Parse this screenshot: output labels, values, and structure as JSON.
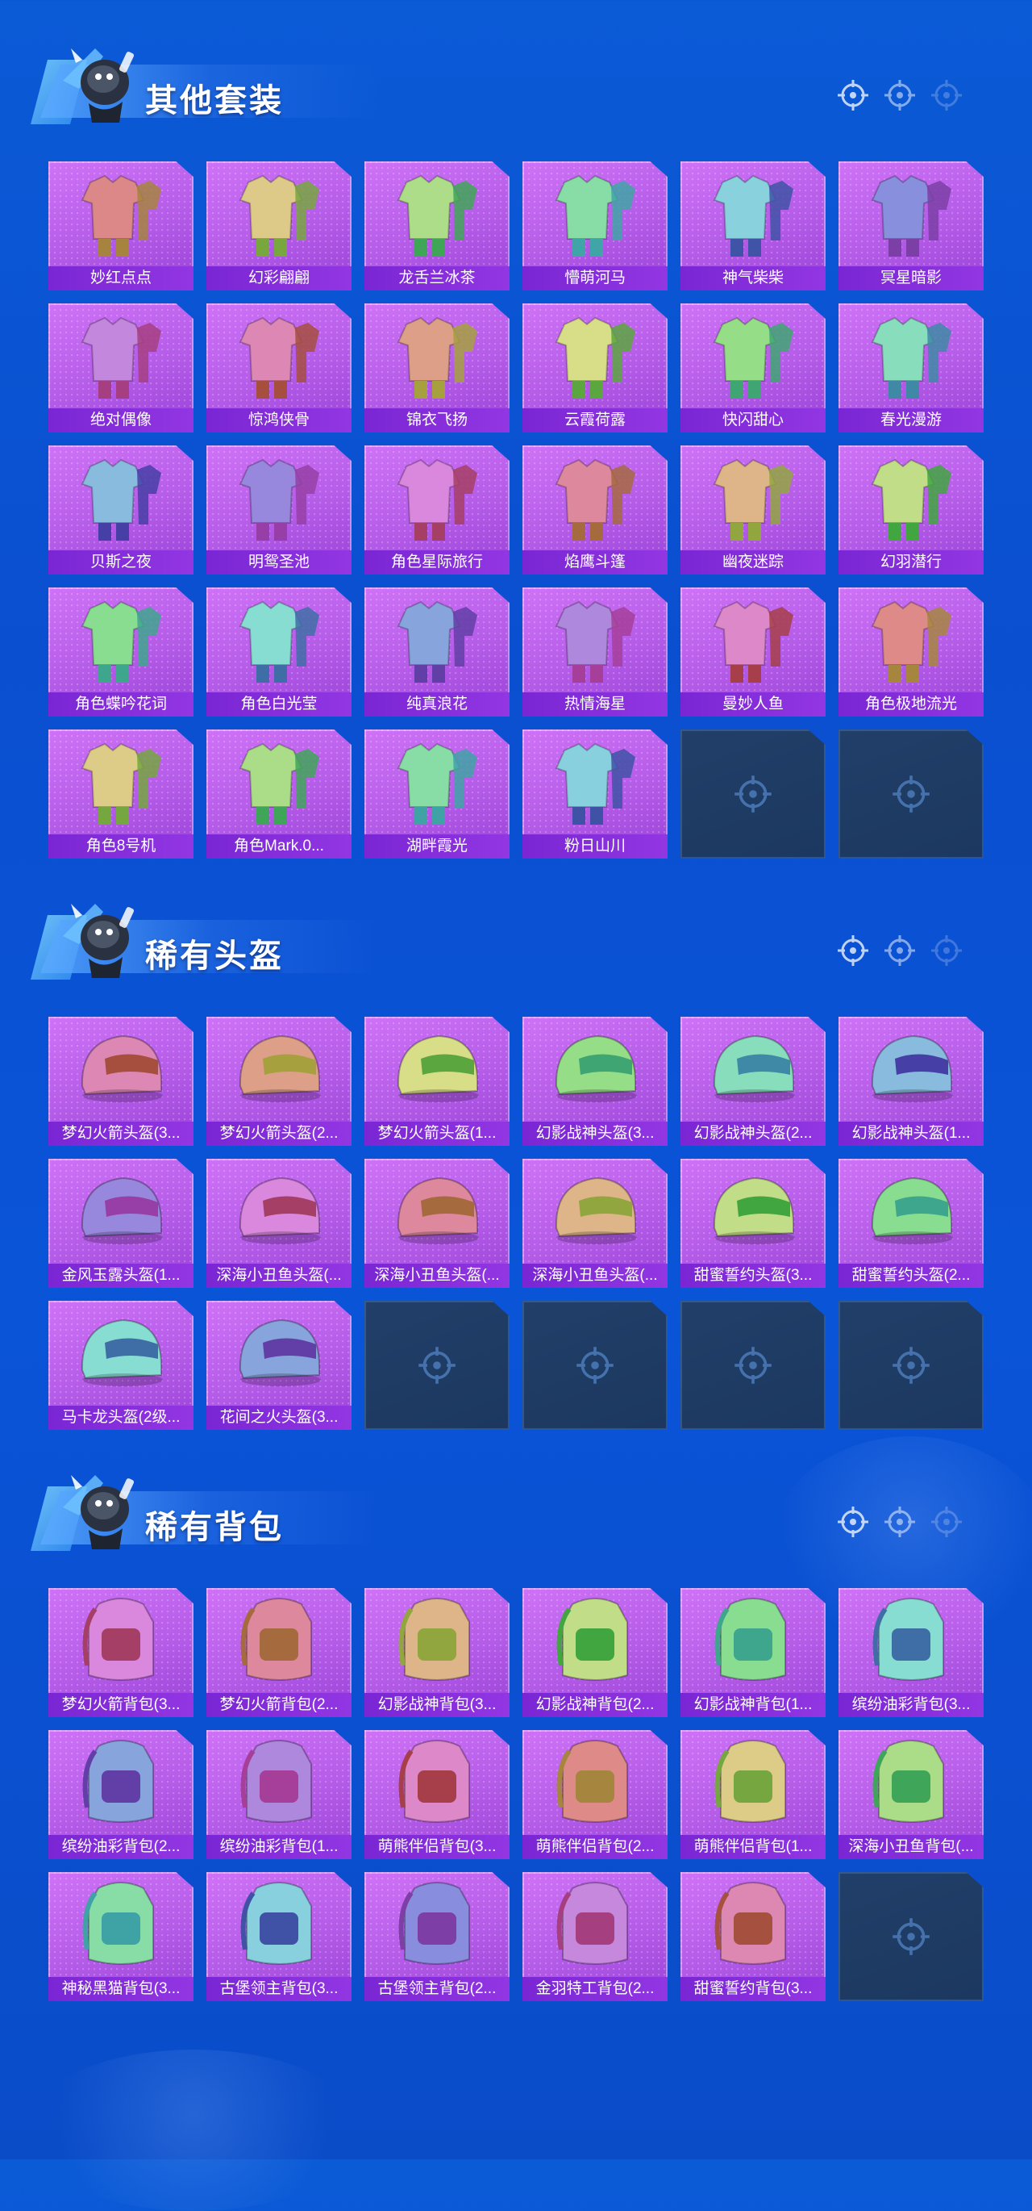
{
  "colors": {
    "page_bg": "#0a52d4",
    "card_purple": "#b45be8",
    "label_purple": "#7a26d4",
    "empty_slot": "#213f69",
    "title_text": "#ffffff"
  },
  "sections": [
    {
      "title": "其他套装",
      "items": [
        "妙红点点",
        "幻彩翩翩",
        "龙舌兰冰茶",
        "懵萌河马",
        "神气柴柴",
        "冥星暗影",
        "绝对偶像",
        "惊鸿侠骨",
        "锦衣飞扬",
        "云霞荷露",
        "快闪甜心",
        "春光漫游",
        "贝斯之夜",
        "明鸳圣池",
        "角色星际旅行",
        "焰鹰斗篷",
        "幽夜迷踪",
        "幻羽潜行",
        "角色蝶吟花词",
        "角色白光莹",
        "纯真浪花",
        "热情海星",
        "曼妙人鱼",
        "角色极地流光",
        "角色8号机",
        "角色Mark.0...",
        "湖畔霞光",
        "粉日山川"
      ],
      "empty_slots": 2
    },
    {
      "title": "稀有头盔",
      "items": [
        "梦幻火箭头盔(3...",
        "梦幻火箭头盔(2...",
        "梦幻火箭头盔(1...",
        "幻影战神头盔(3...",
        "幻影战神头盔(2...",
        "幻影战神头盔(1...",
        "金风玉露头盔(1...",
        "深海小丑鱼头盔(...",
        "深海小丑鱼头盔(...",
        "深海小丑鱼头盔(...",
        "甜蜜誓约头盔(3...",
        "甜蜜誓约头盔(2...",
        "马卡龙头盔(2级...",
        "花间之火头盔(3..."
      ],
      "empty_slots": 4
    },
    {
      "title": "稀有背包",
      "items": [
        "梦幻火箭背包(3...",
        "梦幻火箭背包(2...",
        "幻影战神背包(3...",
        "幻影战神背包(2...",
        "幻影战神背包(1...",
        "缤纷油彩背包(3...",
        "缤纷油彩背包(2...",
        "缤纷油彩背包(1...",
        "萌熊伴侣背包(3...",
        "萌熊伴侣背包(2...",
        "萌熊伴侣背包(1...",
        "深海小丑鱼背包(...",
        "神秘黑猫背包(3...",
        "古堡领主背包(3...",
        "古堡领主背包(2...",
        "金羽特工背包(2...",
        "甜蜜誓约背包(3..."
      ],
      "empty_slots": 1
    }
  ],
  "icons": {
    "section_decoration": "crosshair-icon",
    "empty_slot": "crosshair-icon",
    "mascot": "mascot-figure"
  }
}
